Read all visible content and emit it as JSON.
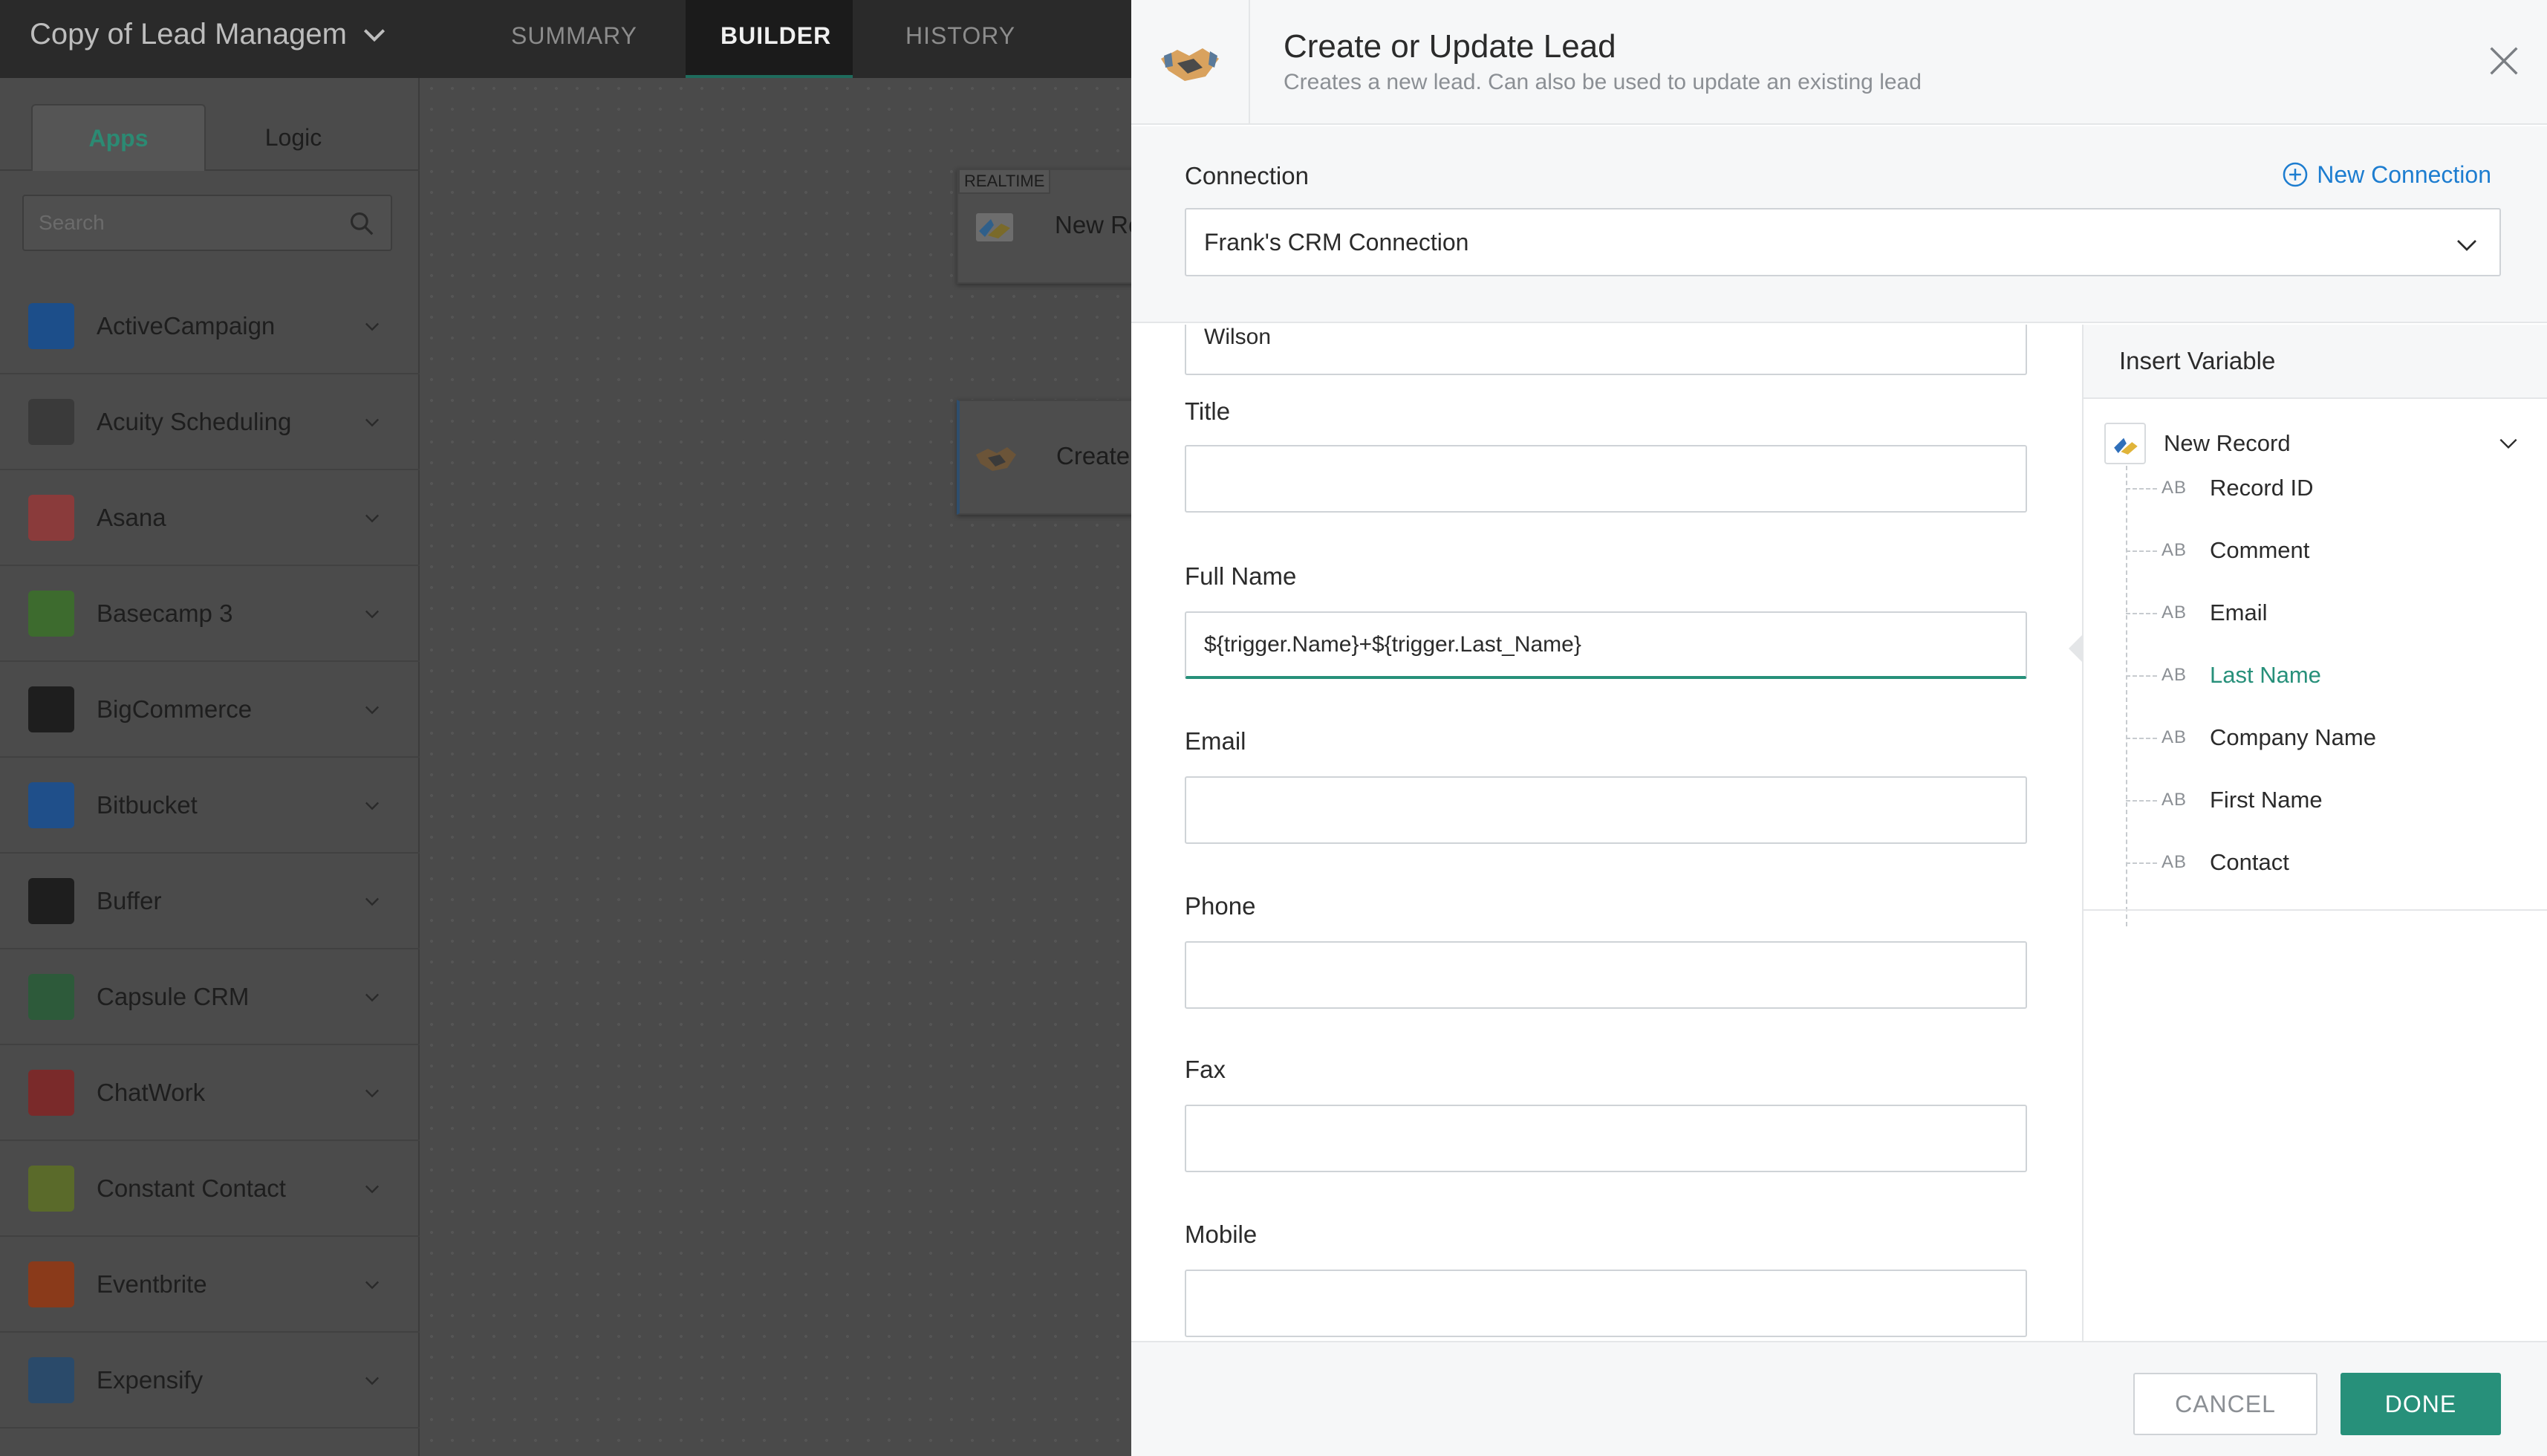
{
  "app": {
    "workflow_title": "Copy of Lead Managem",
    "tabs": [
      "SUMMARY",
      "BUILDER",
      "HISTORY"
    ],
    "active_tab": "BUILDER"
  },
  "sidebar": {
    "tabs": [
      "Apps",
      "Logic"
    ],
    "active_tab": "Apps",
    "search_placeholder": "Search",
    "apps": [
      {
        "name": "ActiveCampaign",
        "icon": "activecampaign-logo",
        "color": "#1c4e8a"
      },
      {
        "name": "Acuity Scheduling",
        "icon": "acuity-logo",
        "color": "#3a3a3a"
      },
      {
        "name": "Asana",
        "icon": "asana-logo",
        "color": "#8a3b3b"
      },
      {
        "name": "Basecamp 3",
        "icon": "basecamp-logo",
        "color": "#3d6b2e"
      },
      {
        "name": "BigCommerce",
        "icon": "bigcommerce-logo",
        "color": "#1e1e1e"
      },
      {
        "name": "Bitbucket",
        "icon": "bitbucket-logo",
        "color": "#1f4f8a"
      },
      {
        "name": "Buffer",
        "icon": "buffer-logo",
        "color": "#1e1e1e"
      },
      {
        "name": "Capsule CRM",
        "icon": "capsule-logo",
        "color": "#2d5a3a"
      },
      {
        "name": "ChatWork",
        "icon": "chatwork-logo",
        "color": "#7a2a2a"
      },
      {
        "name": "Constant Contact",
        "icon": "constantcontact-logo",
        "color": "#5a6a2a"
      },
      {
        "name": "Eventbrite",
        "icon": "eventbrite-logo",
        "color": "#8a3a1a"
      },
      {
        "name": "Expensify",
        "icon": "expensify-logo",
        "color": "#2a4a6a"
      }
    ]
  },
  "canvas": {
    "nodes": [
      {
        "label": "New Re",
        "tag": "REALTIME",
        "icon": "new-record-icon"
      },
      {
        "label": "Create",
        "icon": "handshake-icon"
      }
    ]
  },
  "panel": {
    "title": "Create or Update Lead",
    "subtitle": "Creates a new lead. Can also be used to update an existing lead",
    "icon": "handshake-icon",
    "connection_label": "Connection",
    "new_connection_label": "New Connection",
    "connection_value": "Frank's CRM Connection",
    "partial_prev_value": "Wilson",
    "fields": [
      {
        "label": "Title",
        "value": ""
      },
      {
        "label": "Full Name",
        "value": "${trigger.Name}+${trigger.Last_Name}",
        "focused": true
      },
      {
        "label": "Email",
        "value": ""
      },
      {
        "label": "Phone",
        "value": ""
      },
      {
        "label": "Fax",
        "value": ""
      },
      {
        "label": "Mobile",
        "value": ""
      }
    ],
    "insert_variable": {
      "title": "Insert Variable",
      "group": "New Record",
      "type_tag": "AB",
      "items": [
        "Record ID",
        "Comment",
        "Email",
        "Last Name",
        "Company Name",
        "First Name",
        "Contact"
      ],
      "highlighted": "Last Name"
    },
    "cancel_label": "CANCEL",
    "done_label": "DONE"
  },
  "colors": {
    "accent": "#27907a",
    "link": "#1d7dd0"
  }
}
